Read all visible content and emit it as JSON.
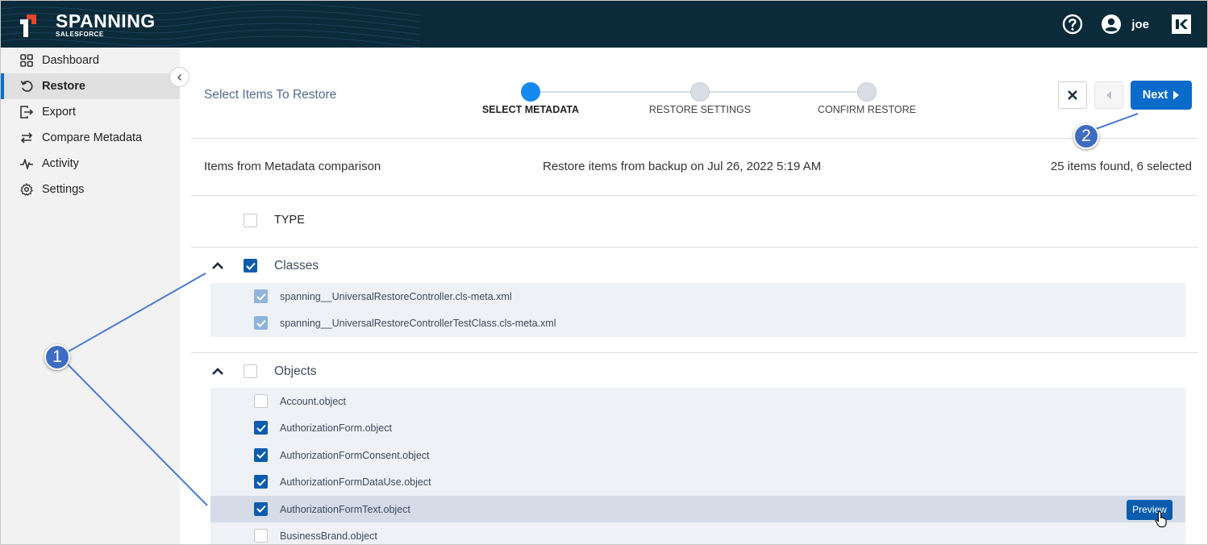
{
  "app": {
    "logo_name": "SPANNING",
    "logo_sub": "SALESFORCE",
    "user_name": "joe",
    "icons": {
      "help": "help-icon",
      "user": "user-avatar-icon",
      "brand": "brand-logo-icon"
    }
  },
  "sidebar": {
    "items": [
      {
        "label": "Dashboard",
        "icon": "grid-icon",
        "active": false
      },
      {
        "label": "Restore",
        "icon": "restore-icon",
        "active": true
      },
      {
        "label": "Export",
        "icon": "export-icon",
        "active": false
      },
      {
        "label": "Compare Metadata",
        "icon": "compare-icon",
        "active": false
      },
      {
        "label": "Activity",
        "icon": "activity-icon",
        "active": false
      },
      {
        "label": "Settings",
        "icon": "gear-icon",
        "active": false
      }
    ]
  },
  "main": {
    "page_title": "Select Items To Restore",
    "steps": [
      {
        "label": "SELECT METADATA",
        "active": true
      },
      {
        "label": "RESTORE SETTINGS",
        "active": false
      },
      {
        "label": "CONFIRM RESTORE",
        "active": false
      }
    ],
    "next_label": "Next",
    "info": {
      "left": "Items from Metadata comparison",
      "middle": "Restore items from backup on Jul 26, 2022 5:19 AM",
      "right": "25 items found, 6 selected"
    },
    "type_header": "TYPE",
    "groups": [
      {
        "label": "Classes",
        "checked": true,
        "items": [
          {
            "label": "spanning__UniversalRestoreController.cls-meta.xml",
            "checked": true
          },
          {
            "label": "spanning__UniversalRestoreControllerTestClass.cls-meta.xml",
            "checked": true
          }
        ]
      },
      {
        "label": "Objects",
        "checked": false,
        "items": [
          {
            "label": "Account.object",
            "checked": false
          },
          {
            "label": "AuthorizationForm.object",
            "checked": true
          },
          {
            "label": "AuthorizationFormConsent.object",
            "checked": true
          },
          {
            "label": "AuthorizationFormDataUse.object",
            "checked": true
          },
          {
            "label": "AuthorizationFormText.object",
            "checked": true,
            "preview": "Preview"
          },
          {
            "label": "BusinessBrand.object",
            "checked": false
          }
        ]
      }
    ]
  },
  "callouts": {
    "one": "1",
    "two": "2"
  },
  "colors": {
    "topbar": "#0b2a3a",
    "accent": "#0b6bcb",
    "step_active": "#1589ee",
    "callout": "#3d6cc2"
  }
}
